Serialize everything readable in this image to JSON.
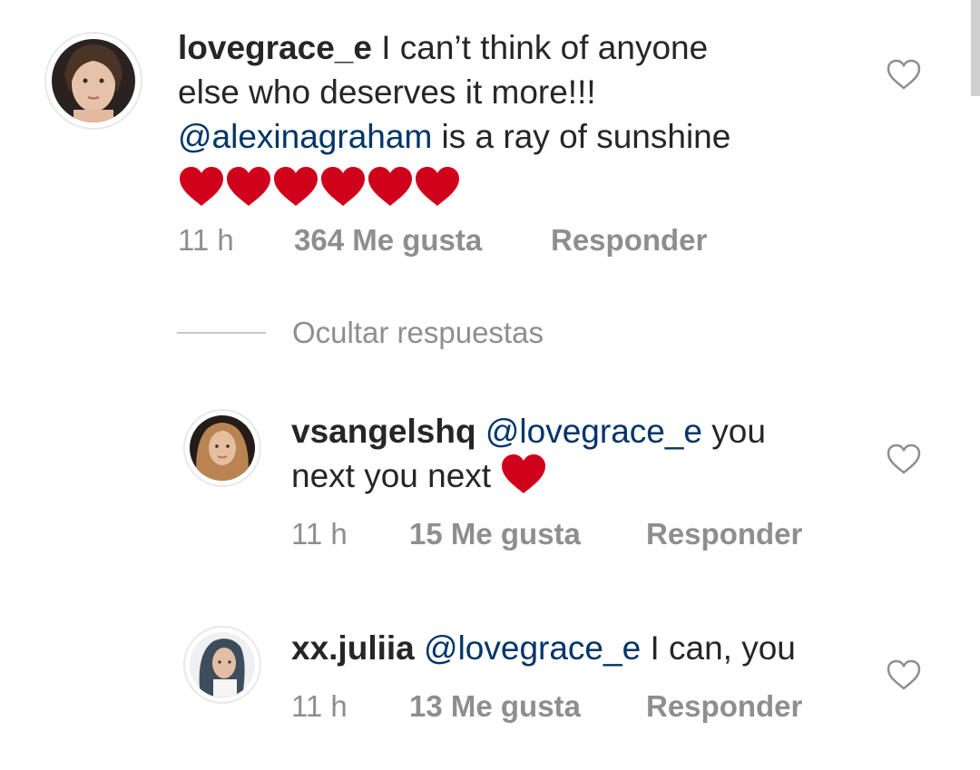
{
  "comments": [
    {
      "username": "lovegrace_e",
      "text_line1": " I can’t think of anyone",
      "text_line2": "else who deserves it more!!!",
      "mention": "@alexinagraham",
      "text_after_mention": " is a ray of sunshine",
      "heart_count": 6,
      "time": "11 h",
      "likes": "364 Me gusta",
      "reply": "Responder"
    }
  ],
  "replies_toggle": "Ocultar respuestas",
  "replies": [
    {
      "username": "vsangelshq",
      "mention": "@lovegrace_e",
      "text_after_mention": " you",
      "text_line2": "next you next ",
      "time": "11 h",
      "likes": "15 Me gusta",
      "reply": "Responder"
    },
    {
      "username": "xx.juliia",
      "mention": "@lovegrace_e",
      "text_after_mention": " I can, you",
      "time": "11 h",
      "likes": "13 Me gusta",
      "reply": "Responder"
    }
  ],
  "colors": {
    "mention": "#003569",
    "meta": "#8e8e8e",
    "heart_emoji": "#d0021b"
  }
}
